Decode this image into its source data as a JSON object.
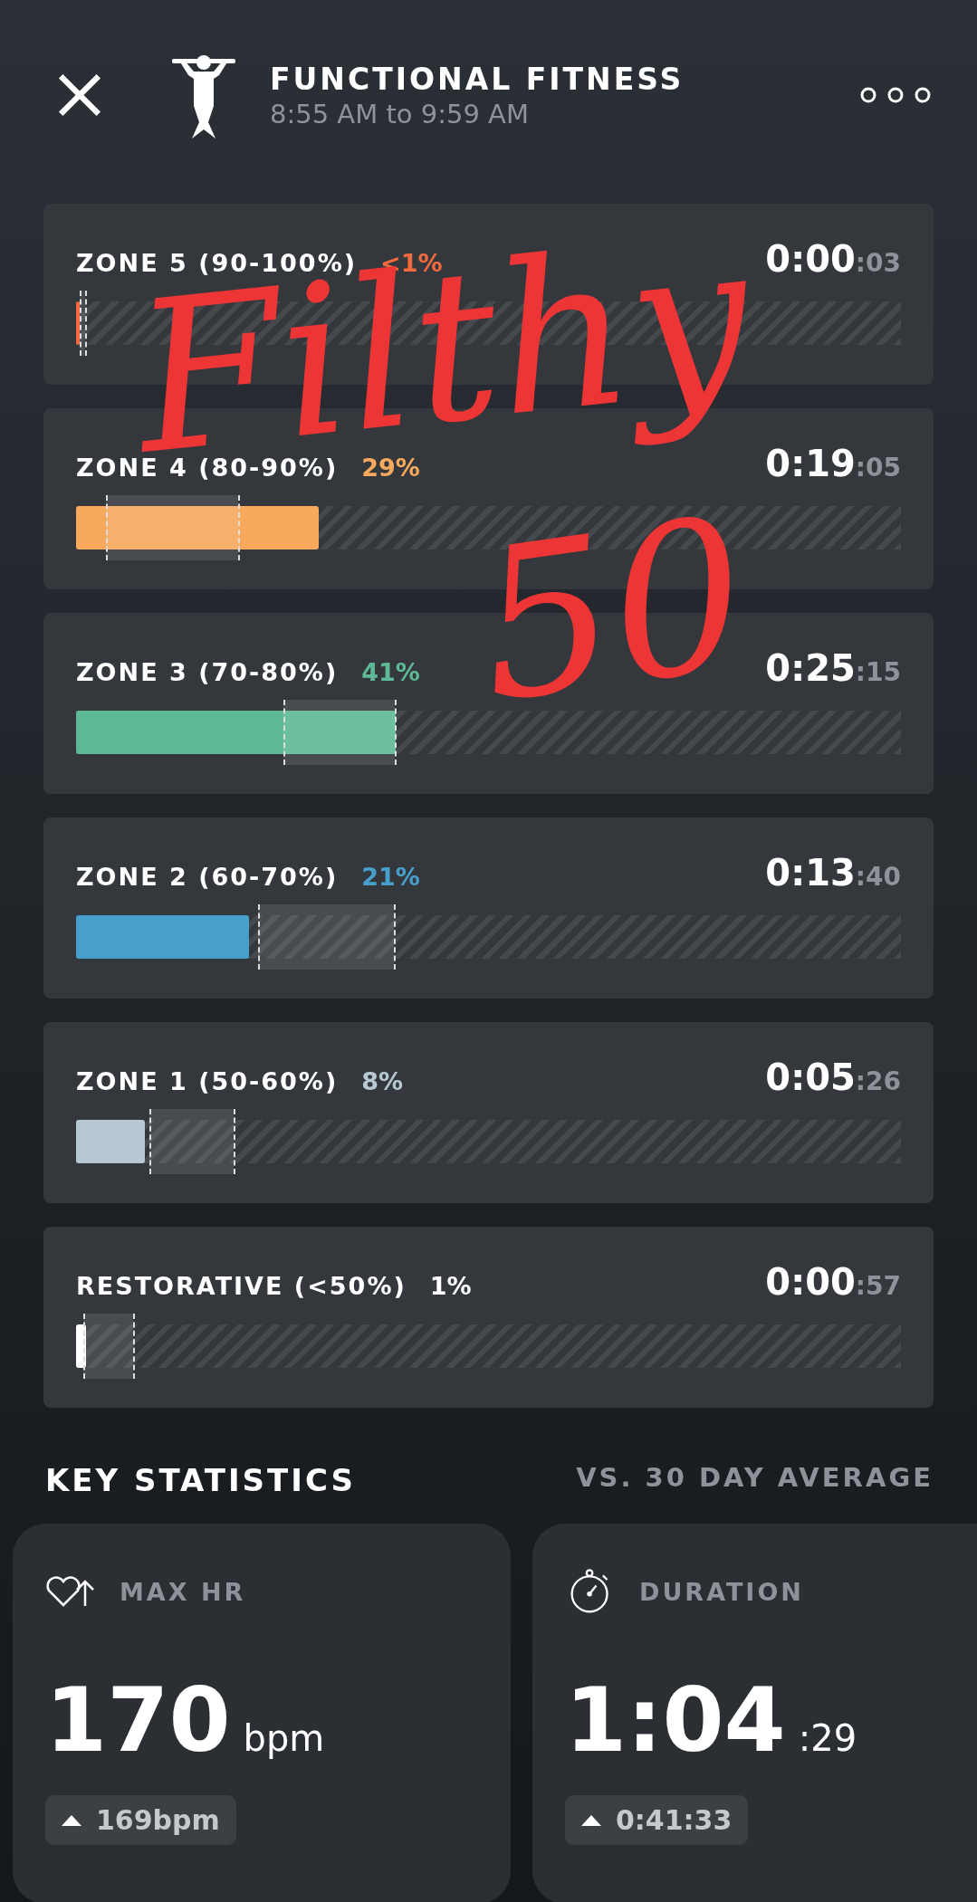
{
  "header": {
    "title": "FUNCTIONAL FITNESS",
    "subtitle": "8:55 AM to 9:59 AM"
  },
  "zones": [
    {
      "label": "ZONE 5 (90-100%)",
      "percent": "<1%",
      "color": "#f26a3d",
      "time_main": "0:00",
      "time_sec": ":03",
      "level": 0.004,
      "markers": [
        {
          "level": 0.004
        },
        {
          "level": 0.011
        }
      ]
    },
    {
      "label": "ZONE 4 (80-90%)",
      "percent": "29%",
      "color": "#f8a95c",
      "time_main": "0:19",
      "time_sec": ":05",
      "level": 0.294,
      "markers": [
        {
          "level": 0.036
        },
        {
          "level": 0.196
        }
      ]
    },
    {
      "label": "ZONE 3 (70-80%)",
      "percent": "41%",
      "color": "#5cb895",
      "time_main": "0:25",
      "time_sec": ":15",
      "level": 0.387,
      "markers": [
        {
          "level": 0.251
        },
        {
          "level": 0.386
        }
      ]
    },
    {
      "label": "ZONE 2 (60-70%)",
      "percent": "21%",
      "color": "#47a0cc",
      "time_main": "0:13",
      "time_sec": ":40",
      "level": 0.21,
      "markers": [
        {
          "level": 0.221
        },
        {
          "level": 0.385
        }
      ]
    },
    {
      "label": "ZONE 1 (50-60%)",
      "percent": "8%",
      "color": "#b6c9d3",
      "time_main": "0:05",
      "time_sec": ":26",
      "level": 0.083,
      "markers": [
        {
          "level": 0.089
        },
        {
          "level": 0.191
        }
      ]
    },
    {
      "label": "RESTORATIVE (<50%)",
      "percent": "1%",
      "color": "#ffffff",
      "time_main": "0:00",
      "time_sec": ":57",
      "level": 0.012,
      "markers": [
        {
          "level": 0.009
        },
        {
          "level": 0.069
        }
      ]
    }
  ],
  "key_statistics": {
    "title": "KEY STATISTICS",
    "comparison": "VS. 30 DAY AVERAGE",
    "stats": [
      {
        "kind": "heart",
        "label": "MAX HR",
        "value": "170",
        "unit": "bpm",
        "change": "169bpm"
      },
      {
        "kind": "stopwatch",
        "label": "DURATION",
        "value": "1:04",
        "unit": ":29",
        "change": "0:41:33"
      }
    ]
  },
  "annotation": {
    "word": "Filthy",
    "number": "50"
  }
}
